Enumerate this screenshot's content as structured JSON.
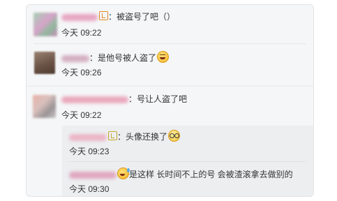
{
  "comments": [
    {
      "text": "：被盗号了吧（）",
      "time": "今天 09:22",
      "avatar_colors": [
        "#a7d0b4",
        "#d6a3c9",
        "#8fb99c",
        "#c58ab8"
      ]
    },
    {
      "text": "：是他号被人盗了",
      "emoji": "laugh-emoji",
      "time": "今天 09:26",
      "avatar_colors": [
        "#6b5446",
        "#9a8273"
      ]
    },
    {
      "text": "：号让人盗了吧",
      "time": "今天 09:22",
      "avatar_colors": [
        "#e9b2a6",
        "#c9c3c3",
        "#9a9496"
      ]
    }
  ],
  "replies": [
    {
      "text": "：头像还换了",
      "emoji": "glasses-emoji",
      "time": "今天 09:23"
    },
    {
      "text": "是这样 长时间不上的号 会被渣滚拿去做别的",
      "emoji": "sweat-emoji",
      "time": "今天 09:30"
    }
  ],
  "colors": {
    "panel_bg": "#f5f6f7",
    "nested_bg": "#eceef0",
    "badge_orange": "#e28a2b",
    "badge_gold": "#c9a62d"
  }
}
